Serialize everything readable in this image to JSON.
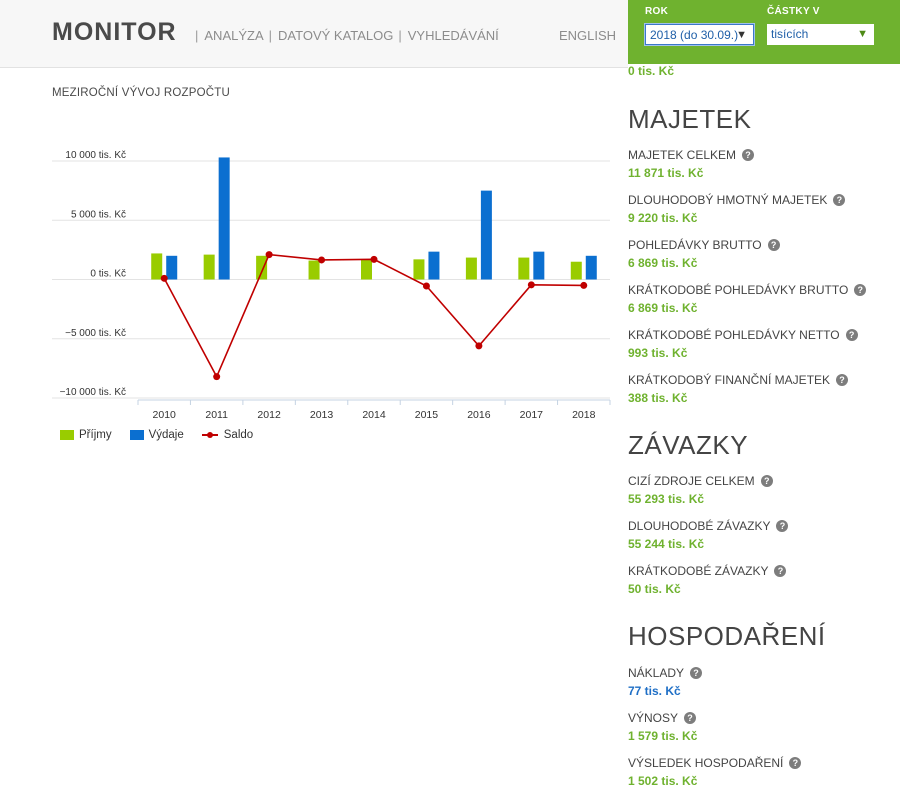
{
  "header": {
    "logo": "MONITOR",
    "nav": [
      "ANALÝZA",
      "DATOVÝ KATALOG",
      "VYHLEDÁVÁNÍ"
    ],
    "nav_separator": "|",
    "language": "ENGLISH"
  },
  "filters": {
    "year_label": "ROK",
    "year_value": "2018 (do 30.09.)",
    "units_label": "ČÁSTKY V",
    "units_value": "tisících",
    "accent_color": "#6fb22f"
  },
  "chart_section": {
    "title": "MEZIROČNÍ VÝVOJ ROZPOČTU"
  },
  "chart_data": {
    "type": "bar",
    "title": "MEZIROČNÍ VÝVOJ ROZPOČTU",
    "categories": [
      "2010",
      "2011",
      "2012",
      "2013",
      "2014",
      "2015",
      "2016",
      "2017",
      "2018"
    ],
    "series": [
      {
        "name": "Příjmy",
        "type": "bar",
        "color": "#99cc00",
        "values": [
          2200,
          2100,
          2000,
          1600,
          1700,
          1700,
          1850,
          1850,
          1500
        ]
      },
      {
        "name": "Výdaje",
        "type": "bar",
        "color": "#0b6fd0",
        "values": [
          2000,
          10300,
          0,
          0,
          0,
          2350,
          7500,
          2350,
          2000
        ]
      },
      {
        "name": "Saldo",
        "type": "line",
        "color": "#c00000",
        "values": [
          100,
          -8200,
          2100,
          1650,
          1700,
          -550,
          -5600,
          -450,
          -500
        ]
      }
    ],
    "yticks": [
      10000,
      5000,
      0,
      -5000,
      -10000
    ],
    "ytick_labels": [
      "10 000 tis. Kč",
      "5 000 tis. Kč",
      "0 tis. Kč",
      "−5 000 tis. Kč",
      "−10 000 tis. Kč"
    ],
    "ylim": [
      -10000,
      10000
    ],
    "grid": true,
    "legend_position": "bottom-left"
  },
  "panel": {
    "cut_value": "0 tis. Kč",
    "sections": [
      {
        "title": "MAJETEK",
        "items": [
          {
            "label": "MAJETEK CELKEM",
            "value": "11 871 tis. Kč"
          },
          {
            "label": "DLOUHODOBÝ HMOTNÝ MAJETEK",
            "value": "9 220 tis. Kč"
          },
          {
            "label": "POHLEDÁVKY BRUTTO",
            "value": "6 869 tis. Kč"
          },
          {
            "label": "KRÁTKODOBÉ POHLEDÁVKY BRUTTO",
            "value": "6 869 tis. Kč"
          },
          {
            "label": "KRÁTKODOBÉ POHLEDÁVKY NETTO",
            "value": "993 tis. Kč"
          },
          {
            "label": "KRÁTKODOBÝ FINANČNÍ MAJETEK",
            "value": "388 tis. Kč"
          }
        ]
      },
      {
        "title": "ZÁVAZKY",
        "items": [
          {
            "label": "CIZÍ ZDROJE CELKEM",
            "value": "55 293 tis. Kč"
          },
          {
            "label": "DLOUHODOBÉ ZÁVAZKY",
            "value": "55 244 tis. Kč"
          },
          {
            "label": "KRÁTKODOBÉ ZÁVAZKY",
            "value": "50 tis. Kč"
          }
        ]
      },
      {
        "title": "HOSPODAŘENÍ",
        "items": [
          {
            "label": "NÁKLADY",
            "value": "77 tis. Kč",
            "value_color": "#1f6fc6"
          },
          {
            "label": "VÝNOSY",
            "value": "1 579 tis. Kč"
          },
          {
            "label": "VÝSLEDEK HOSPODAŘENÍ",
            "value": "1 502 tis. Kč"
          }
        ]
      }
    ],
    "help_glyph": "?"
  }
}
